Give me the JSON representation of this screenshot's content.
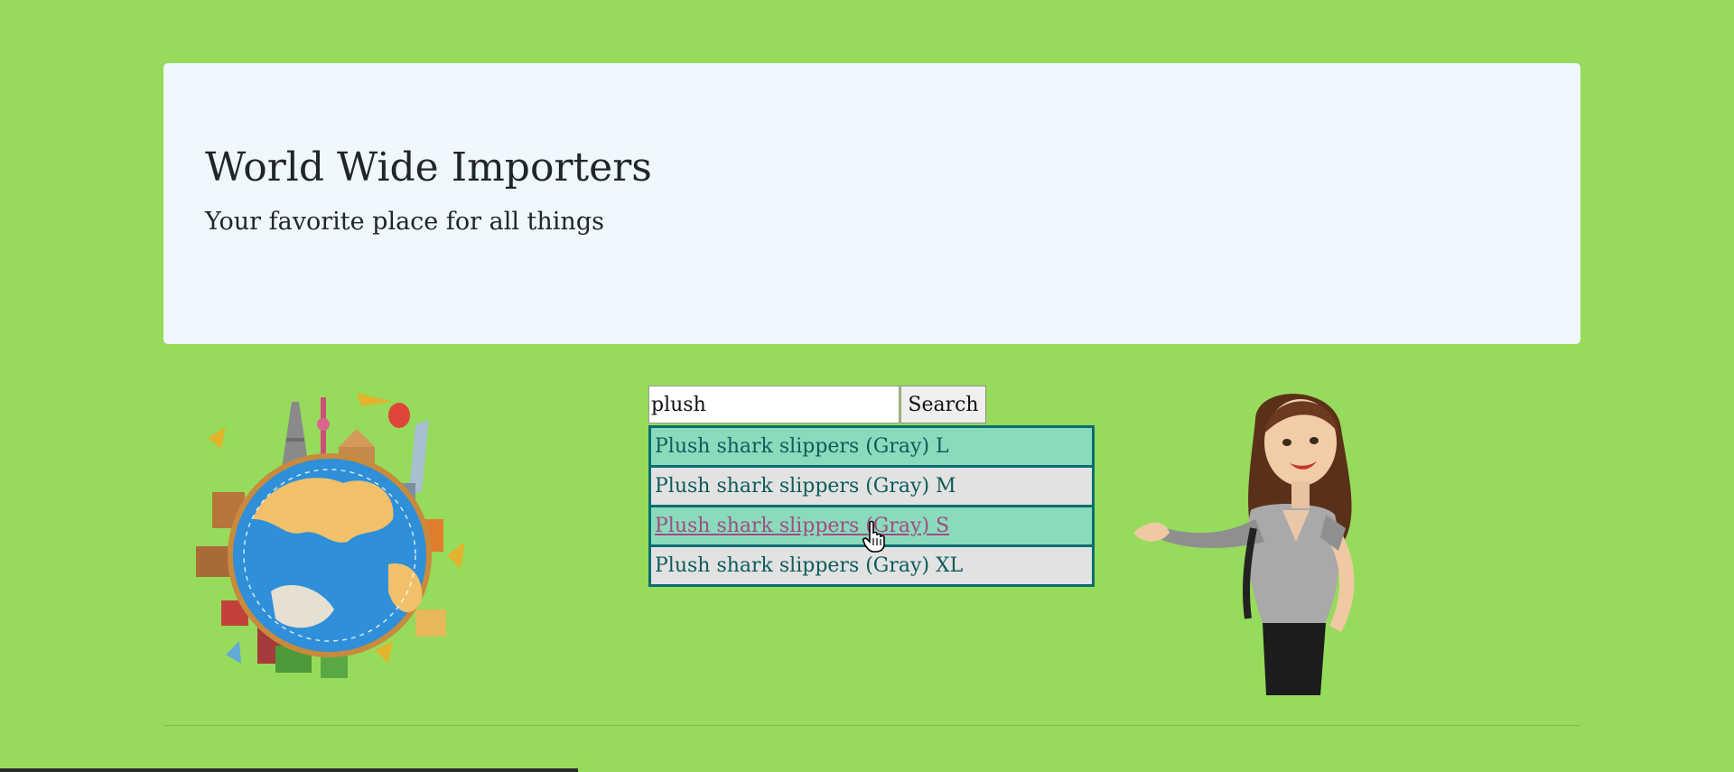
{
  "header": {
    "title": "World Wide Importers",
    "tagline": "Your favorite place for all things"
  },
  "search": {
    "value": "plush",
    "button_label": "Search",
    "suggestions": [
      "Plush shark slippers (Gray) L",
      "Plush shark slippers (Gray) M",
      "Plush shark slippers (Gray) S",
      "Plush shark slippers (Gray) XL"
    ]
  },
  "colors": {
    "page_background": "#96db5b",
    "header_background": "#eff7ff",
    "suggestion_border": "#0a6e6e",
    "suggestion_alt": "#89dbbc",
    "suggestion_plain": "#e2e2e2"
  },
  "images": {
    "left": "globe-landmarks-illustration",
    "right": "woman-presenting-illustration"
  }
}
